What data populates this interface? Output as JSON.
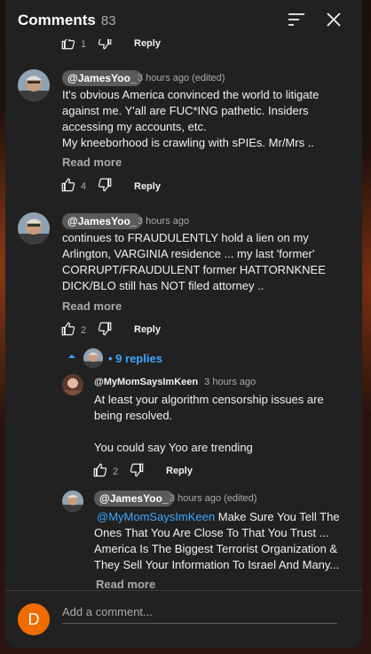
{
  "header": {
    "title": "Comments",
    "count": "83",
    "sort_icon": "sort-icon",
    "close_icon": "close-icon"
  },
  "top_partial": {
    "like_count": "1",
    "reply_label": "Reply"
  },
  "comments": [
    {
      "author": "@JamesYoo_",
      "time": "3 hours ago (edited)",
      "lines": [
        "It's obvious America convinced the world to litigate",
        "against me. Y'all are FUC*ING pathetic. Insiders",
        "accessing my accounts, etc.",
        "My kneeborhood is crawling with sPIEs. Mr/Mrs .."
      ],
      "read_more": "Read more",
      "likes": "4",
      "reply_label": "Reply"
    },
    {
      "author": "@JamesYoo_",
      "time": "3 hours ago",
      "lines": [
        "continues to FRAUDULENTLY hold a lien on my",
        "Arlington, VARGINIA residence ... my last 'former'",
        "CORRUPT/FRAUDULENT former HATTORNKNEE",
        "DICK/BLO still has NOT filed attorney .."
      ],
      "read_more": "Read more",
      "likes": "2",
      "reply_label": "Reply",
      "replies_toggle": "• 9 replies"
    }
  ],
  "replies": [
    {
      "author": "@MyMomSaysImKeen",
      "time": "3 hours ago",
      "lines": [
        "At least your algorithm censorship issues are",
        "being resolved."
      ],
      "line_extra": "You could say Yoo are trending",
      "likes": "2",
      "reply_label": "Reply"
    },
    {
      "author": "@JamesYoo_",
      "time": "3 hours ago (edited)",
      "mention": "@MyMomSaysImKeen",
      "line0_rest": " Make Sure You Tell The",
      "lines": [
        "Ones That You Are Close To That You Trust ...",
        "America Is The Biggest Terrorist Organization &",
        "They Sell Your Information To Israel And Many..."
      ],
      "read_more": "Read more"
    }
  ],
  "footer": {
    "avatar_letter": "D",
    "placeholder": "Add a comment..."
  },
  "colors": {
    "panel": "#212121",
    "accent_link": "#3ea6ff",
    "avatar_orange": "#ef6c00"
  }
}
